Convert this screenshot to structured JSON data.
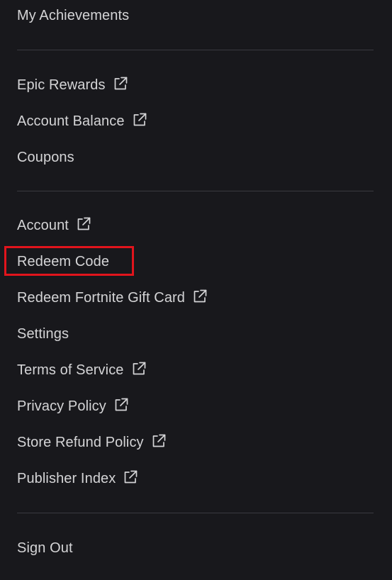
{
  "menu": {
    "items": [
      {
        "label": "My Achievements",
        "external": false
      },
      {
        "label": "Epic Rewards",
        "external": true
      },
      {
        "label": "Account Balance",
        "external": true
      },
      {
        "label": "Coupons",
        "external": false
      },
      {
        "label": "Account",
        "external": true
      },
      {
        "label": "Redeem Code",
        "external": false,
        "highlighted": true
      },
      {
        "label": "Redeem Fortnite Gift Card",
        "external": true
      },
      {
        "label": "Settings",
        "external": false
      },
      {
        "label": "Terms of Service",
        "external": true
      },
      {
        "label": "Privacy Policy",
        "external": true
      },
      {
        "label": "Store Refund Policy",
        "external": true
      },
      {
        "label": "Publisher Index",
        "external": true
      },
      {
        "label": "Sign Out",
        "external": false
      }
    ],
    "highlight_color": "#e1141c",
    "text_color": "#d4d4d6",
    "background_color": "#18181c",
    "external_icon": "external-link-icon"
  }
}
